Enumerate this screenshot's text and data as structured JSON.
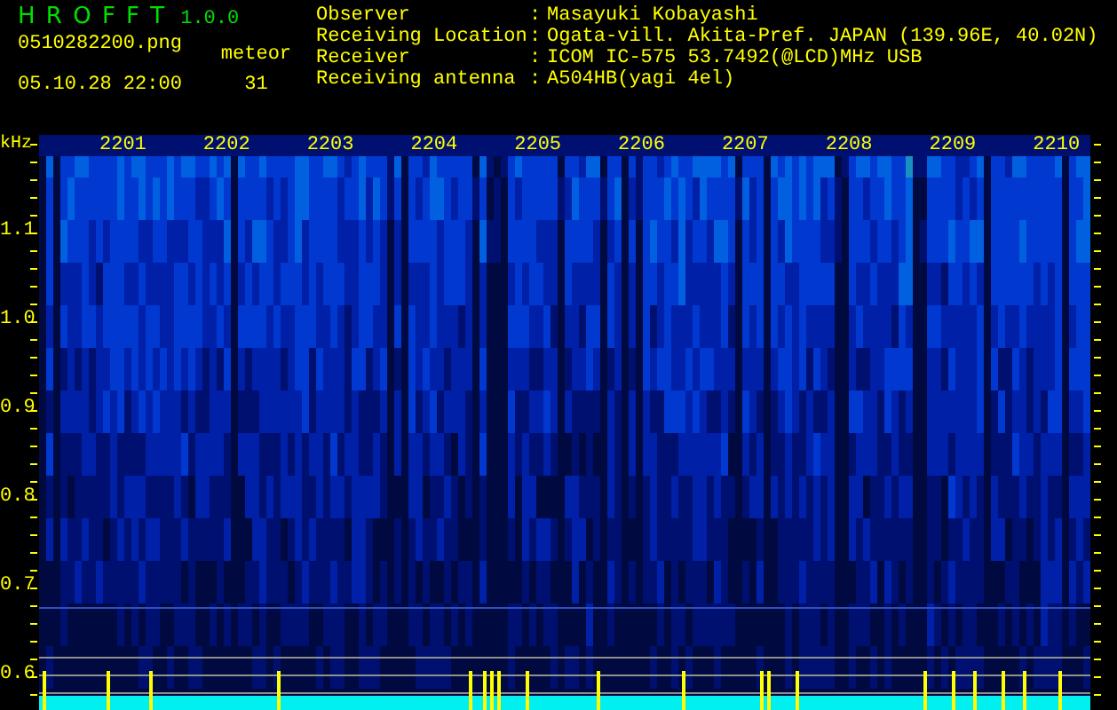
{
  "app": {
    "name": "H R O F F T",
    "version": "1.0.0"
  },
  "file": {
    "name": "0510282200.png",
    "datetime": "05.10.28 22:00"
  },
  "meteor": {
    "label": "meteor",
    "count": "31"
  },
  "info": [
    {
      "label": "Observer",
      "separator": ":",
      "value": "Masayuki Kobayashi"
    },
    {
      "label": "Receiving Location",
      "separator": ":",
      "value": "Ogata-vill. Akita-Pref. JAPAN (139.96E, 40.02N)"
    },
    {
      "label": "Receiver",
      "separator": ":",
      "value": "ICOM IC-575 53.7492(@LCD)MHz USB"
    },
    {
      "label": "Receiving antenna",
      "separator": ":",
      "value": "A504HB(yagi 4el)"
    }
  ],
  "spectrogram": {
    "y_unit": "kHz",
    "y_labels": [
      "1.1",
      "1.0",
      "0.9",
      "0.8",
      "0.7",
      "0.6"
    ],
    "time_labels": [
      "2201",
      "2202",
      "2203",
      "2204",
      "2205",
      "2206",
      "2207",
      "2208",
      "2209",
      "2210"
    ]
  }
}
